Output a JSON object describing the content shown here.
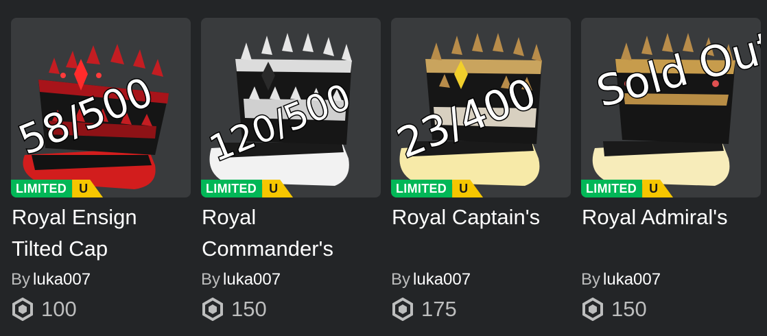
{
  "items": [
    {
      "name": "Royal Ensign Tilted Cap",
      "creator_prefix": "By",
      "creator": "luka007",
      "price": "100",
      "badge_limited": "LIMITED",
      "badge_unique": "U",
      "handwritten_note": "58/500",
      "hat_color": "#c4161c"
    },
    {
      "name": "Royal Commander's",
      "creator_prefix": "By",
      "creator": "luka007",
      "price": "150",
      "badge_limited": "LIMITED",
      "badge_unique": "U",
      "handwritten_note": "120/500",
      "hat_color": "#f0f0f0"
    },
    {
      "name": "Royal Captain's",
      "creator_prefix": "By",
      "creator": "luka007",
      "price": "175",
      "badge_limited": "LIMITED",
      "badge_unique": "U",
      "handwritten_note": "23/400",
      "hat_color": "#f3e7b2"
    },
    {
      "name": "Royal Admiral's",
      "creator_prefix": "By",
      "creator": "luka007",
      "price": "150",
      "badge_limited": "LIMITED",
      "badge_unique": "U",
      "handwritten_note": "Sold Out!",
      "hat_color": "#f5eab8"
    }
  ],
  "colors": {
    "background": "#232527",
    "card_thumb": "#393b3d",
    "limited_badge": "#02b757",
    "unique_badge": "#f6c600",
    "price_text": "#bdbebe"
  },
  "icons": {
    "currency": "robux-icon"
  }
}
